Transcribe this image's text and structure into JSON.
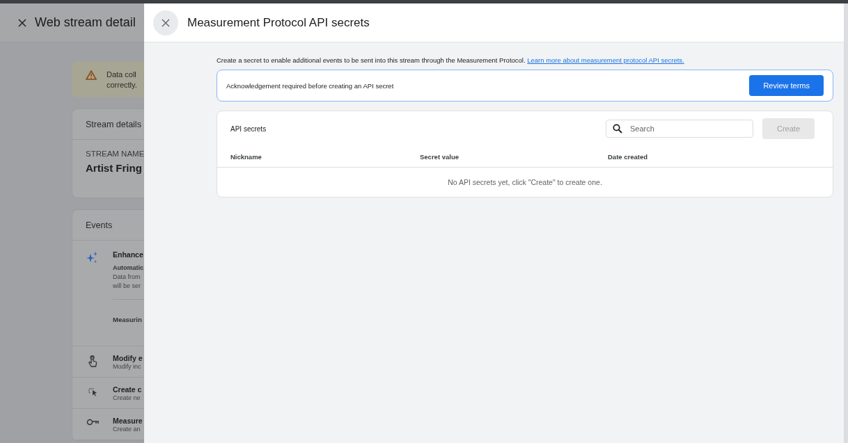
{
  "background_page": {
    "title": "Web stream detail",
    "warning": {
      "lines": [
        "Data coll",
        "correctly."
      ]
    },
    "stream_card": {
      "heading": "Stream details",
      "label": "STREAM NAME",
      "value": "Artist Fring"
    },
    "events_card": {
      "heading": "Events",
      "items": [
        {
          "kind": "enhanced",
          "title": "Enhance",
          "lines": [
            "Automatic",
            "Data from",
            "will be ser"
          ],
          "footer": "Measurin"
        },
        {
          "kind": "modify",
          "title": "Modify e",
          "subtitle": "Modify inc"
        },
        {
          "kind": "create",
          "title": "Create c",
          "subtitle": "Create ne"
        },
        {
          "kind": "measurement",
          "title": "Measure",
          "subtitle": "Create an"
        }
      ]
    }
  },
  "panel": {
    "title": "Measurement Protocol API secrets",
    "description": "Create a secret to enable additional events to be sent into this stream through the Measurement Protocol.",
    "link": "Learn more about measurement protocol API secrets.",
    "acknowledgement": {
      "text": "Acknowledgement required before creating an API secret",
      "button": "Review terms"
    },
    "table": {
      "title": "API secrets",
      "search": {
        "placeholder": "Search"
      },
      "create_button": {
        "label": "Create",
        "disabled": true
      },
      "columns": [
        "Nickname",
        "Secret value",
        "Date created"
      ],
      "empty_message": "No API secrets yet, click \"Create\" to create one."
    }
  }
}
